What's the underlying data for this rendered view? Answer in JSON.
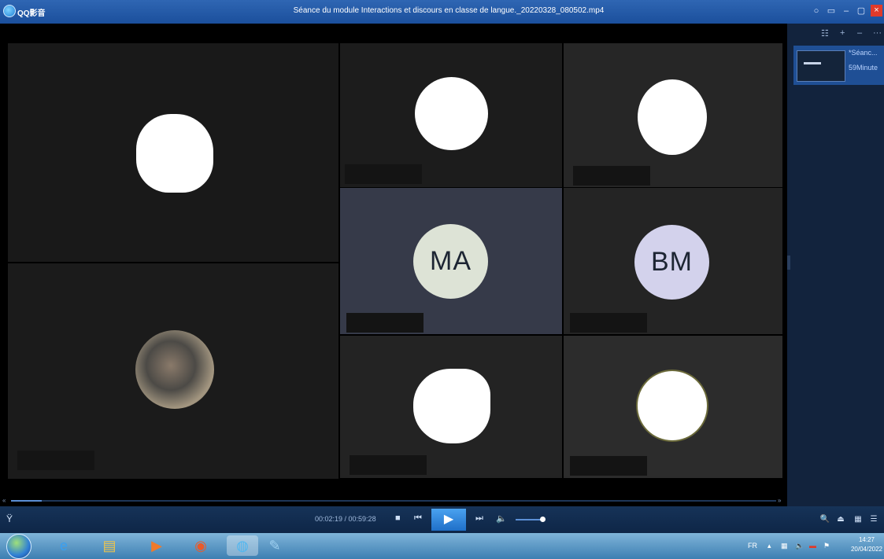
{
  "window": {
    "app_name": "QQ影音",
    "title": "Séance du module Interactions et discours en classe de langue._20220328_080502.mp4",
    "controls": [
      "○",
      "▭",
      "–",
      "▢",
      "×"
    ]
  },
  "participants": [
    {
      "type": "photo"
    },
    {
      "type": "photo"
    },
    {
      "type": "photo"
    },
    {
      "initials": "MA",
      "color": "#dde3d6"
    },
    {
      "initials": "BM",
      "color": "#d3d2ec"
    },
    {
      "type": "photo"
    },
    {
      "type": "photo"
    },
    {
      "type": "photo"
    }
  ],
  "playlist": {
    "tools": [
      "☷",
      "+",
      "–",
      "···"
    ],
    "item_title": "*Séanc...",
    "item_duration": "59Minute"
  },
  "player": {
    "time": "00:02:19 / 00:59:28",
    "progress_fraction": 0.04,
    "volume_fraction": 0.8,
    "buttons": {
      "stop": "■",
      "prev": "⏮",
      "play": "▶",
      "next": "⏭",
      "volume": "🔈"
    },
    "right_buttons": [
      "🔍",
      "⏏",
      "▦",
      "☰"
    ]
  },
  "taskbar": {
    "apps": [
      {
        "name": "internet-explorer",
        "glyph": "e",
        "color": "#3a9ff0"
      },
      {
        "name": "file-explorer",
        "glyph": "▤",
        "color": "#f0c44a"
      },
      {
        "name": "media-player",
        "glyph": "▶",
        "color": "#f07a2a"
      },
      {
        "name": "chrome",
        "glyph": "◉",
        "color": "#e85a2a"
      },
      {
        "name": "qq-player",
        "glyph": "◍",
        "color": "#4fb6f0"
      },
      {
        "name": "paint",
        "glyph": "✎",
        "color": "#9fd0f0"
      }
    ],
    "lang": "FR",
    "time": "14:27",
    "date": "20/04/2022"
  }
}
